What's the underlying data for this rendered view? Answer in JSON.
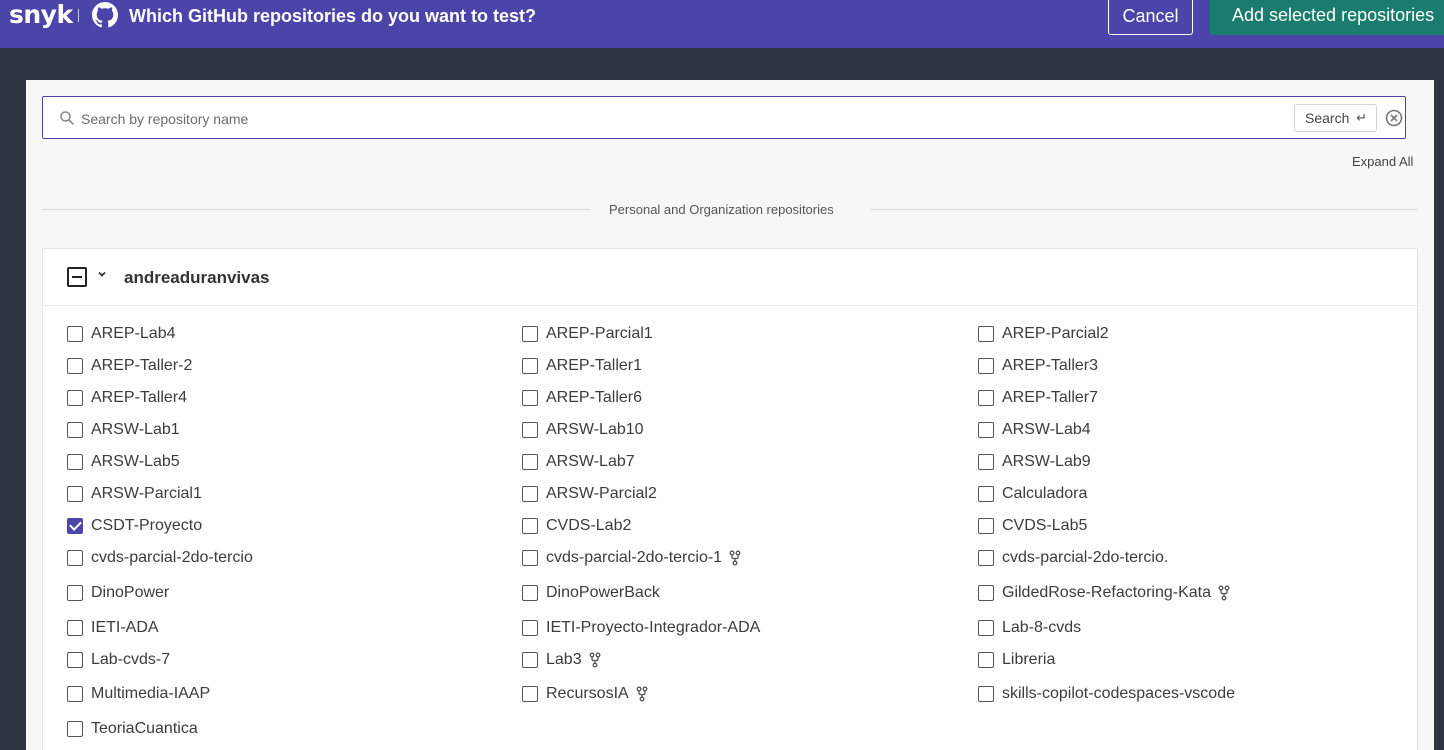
{
  "header": {
    "logo": "snyk",
    "title": "Which GitHub repositories do you want to test?",
    "cancel_label": "Cancel",
    "add_label": "Add selected repositories"
  },
  "search": {
    "placeholder": "Search by repository name",
    "button_label": "Search",
    "button_glyph": "↵"
  },
  "expand_all_label": "Expand All",
  "section_label": "Personal and Organization repositories",
  "org": {
    "name": "andreaduranvivas",
    "repos": [
      {
        "name": "AREP-Lab4",
        "checked": false,
        "fork": false
      },
      {
        "name": "AREP-Parcial1",
        "checked": false,
        "fork": false
      },
      {
        "name": "AREP-Parcial2",
        "checked": false,
        "fork": false
      },
      {
        "name": "AREP-Taller-2",
        "checked": false,
        "fork": false
      },
      {
        "name": "AREP-Taller1",
        "checked": false,
        "fork": false
      },
      {
        "name": "AREP-Taller3",
        "checked": false,
        "fork": false
      },
      {
        "name": "AREP-Taller4",
        "checked": false,
        "fork": false
      },
      {
        "name": "AREP-Taller6",
        "checked": false,
        "fork": false
      },
      {
        "name": "AREP-Taller7",
        "checked": false,
        "fork": false
      },
      {
        "name": "ARSW-Lab1",
        "checked": false,
        "fork": false
      },
      {
        "name": "ARSW-Lab10",
        "checked": false,
        "fork": false
      },
      {
        "name": "ARSW-Lab4",
        "checked": false,
        "fork": false
      },
      {
        "name": "ARSW-Lab5",
        "checked": false,
        "fork": false
      },
      {
        "name": "ARSW-Lab7",
        "checked": false,
        "fork": false
      },
      {
        "name": "ARSW-Lab9",
        "checked": false,
        "fork": false
      },
      {
        "name": "ARSW-Parcial1",
        "checked": false,
        "fork": false
      },
      {
        "name": "ARSW-Parcial2",
        "checked": false,
        "fork": false
      },
      {
        "name": "Calculadora",
        "checked": false,
        "fork": false
      },
      {
        "name": "CSDT-Proyecto",
        "checked": true,
        "fork": false
      },
      {
        "name": "CVDS-Lab2",
        "checked": false,
        "fork": false
      },
      {
        "name": "CVDS-Lab5",
        "checked": false,
        "fork": false
      },
      {
        "name": "cvds-parcial-2do-tercio",
        "checked": false,
        "fork": false
      },
      {
        "name": "cvds-parcial-2do-tercio-1",
        "checked": false,
        "fork": true
      },
      {
        "name": "cvds-parcial-2do-tercio.",
        "checked": false,
        "fork": false
      },
      {
        "name": "DinoPower",
        "checked": false,
        "fork": false
      },
      {
        "name": "DinoPowerBack",
        "checked": false,
        "fork": false
      },
      {
        "name": "GildedRose-Refactoring-Kata",
        "checked": false,
        "fork": true
      },
      {
        "name": "IETI-ADA",
        "checked": false,
        "fork": false
      },
      {
        "name": "IETI-Proyecto-Integrador-ADA",
        "checked": false,
        "fork": false
      },
      {
        "name": "Lab-8-cvds",
        "checked": false,
        "fork": false
      },
      {
        "name": "Lab-cvds-7",
        "checked": false,
        "fork": false
      },
      {
        "name": "Lab3",
        "checked": false,
        "fork": true
      },
      {
        "name": "Libreria",
        "checked": false,
        "fork": false
      },
      {
        "name": "Multimedia-IAAP",
        "checked": false,
        "fork": false
      },
      {
        "name": "RecursosIA",
        "checked": false,
        "fork": true
      },
      {
        "name": "skills-copilot-codespaces-vscode",
        "checked": false,
        "fork": false
      },
      {
        "name": "TeoriaCuantica",
        "checked": false,
        "fork": false
      }
    ]
  }
}
